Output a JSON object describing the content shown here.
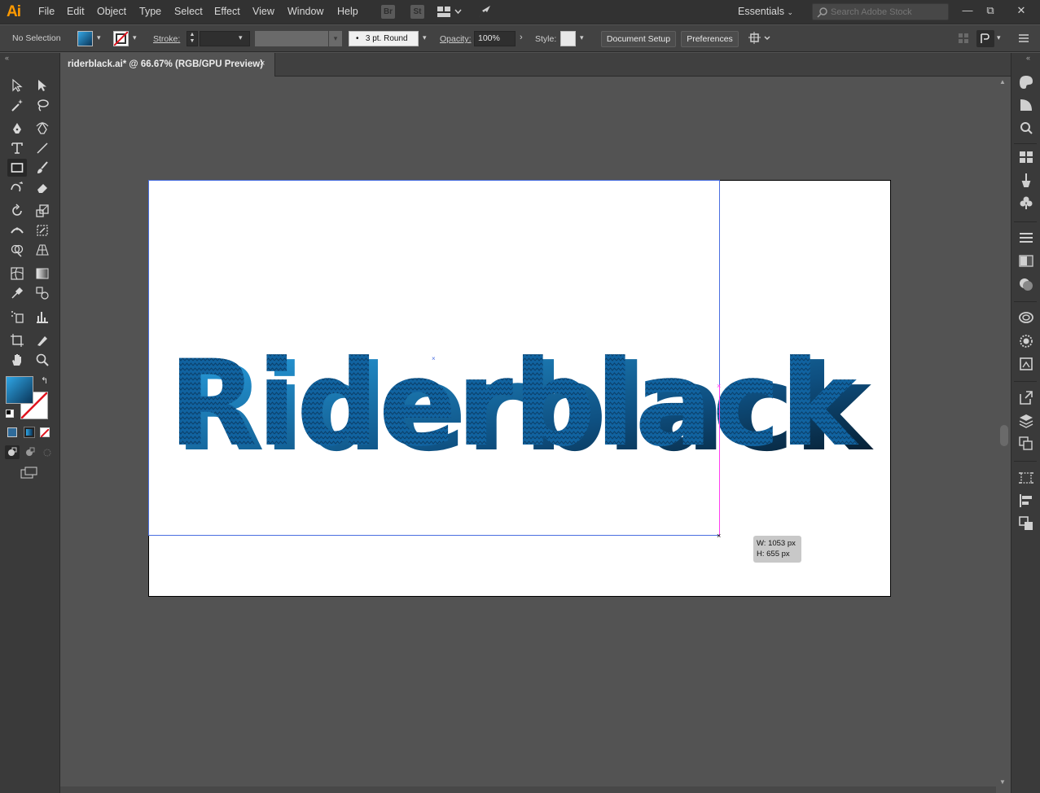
{
  "app": {
    "logo": "Ai",
    "menu": [
      "File",
      "Edit",
      "Object",
      "Type",
      "Select",
      "Effect",
      "View",
      "Window",
      "Help"
    ],
    "bridge_label": "Br",
    "stock_label": "St",
    "workspace": "Essentials",
    "search_placeholder": "Search Adobe Stock",
    "window_controls": [
      "—",
      "⧉",
      "✕"
    ]
  },
  "control_bar": {
    "selection_label": "No Selection",
    "stroke_label": "Stroke:",
    "brush_value": "3 pt. Round",
    "opacity_label": "Opacity:",
    "opacity_value": "100%",
    "style_label": "Style:",
    "document_setup": "Document Setup",
    "preferences": "Preferences"
  },
  "document": {
    "tab_title": "riderblack.ai* @ 66.67% (RGB/GPU Preview)",
    "close_glyph": "×"
  },
  "artwork": {
    "wordmark_text": "Riderblack",
    "fill_colors": [
      "#0d4a7a",
      "#1f8fd1"
    ]
  },
  "tooltip": {
    "width": "W: 1053 px",
    "height": "H: 655 px"
  },
  "colors": {
    "accent_guide": "#ff3ef0",
    "selection": "#4a6fe0",
    "fill_gradient_start": "#1f8fd1",
    "fill_gradient_end": "#0a3558"
  }
}
